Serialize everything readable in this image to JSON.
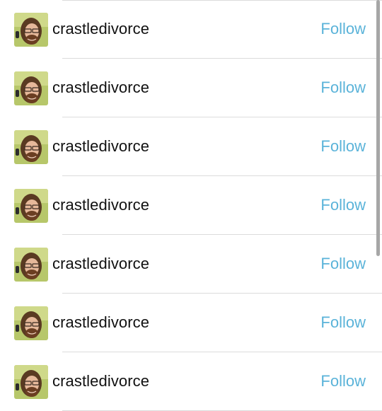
{
  "users": [
    {
      "username": "crastledivorce",
      "action": "Follow",
      "avatar_icon": "user-avatar-photo"
    },
    {
      "username": "crastledivorce",
      "action": "Follow",
      "avatar_icon": "user-avatar-photo"
    },
    {
      "username": "crastledivorce",
      "action": "Follow",
      "avatar_icon": "user-avatar-photo"
    },
    {
      "username": "crastledivorce",
      "action": "Follow",
      "avatar_icon": "user-avatar-photo"
    },
    {
      "username": "crastledivorce",
      "action": "Follow",
      "avatar_icon": "user-avatar-photo"
    },
    {
      "username": "crastledivorce",
      "action": "Follow",
      "avatar_icon": "user-avatar-photo"
    },
    {
      "username": "crastledivorce",
      "action": "Follow",
      "avatar_icon": "user-avatar-photo"
    }
  ],
  "colors": {
    "follow": "#5ab3d9",
    "text": "#111111",
    "divider": "#dcdcdc",
    "scrollbar": "#a6a6a6"
  }
}
